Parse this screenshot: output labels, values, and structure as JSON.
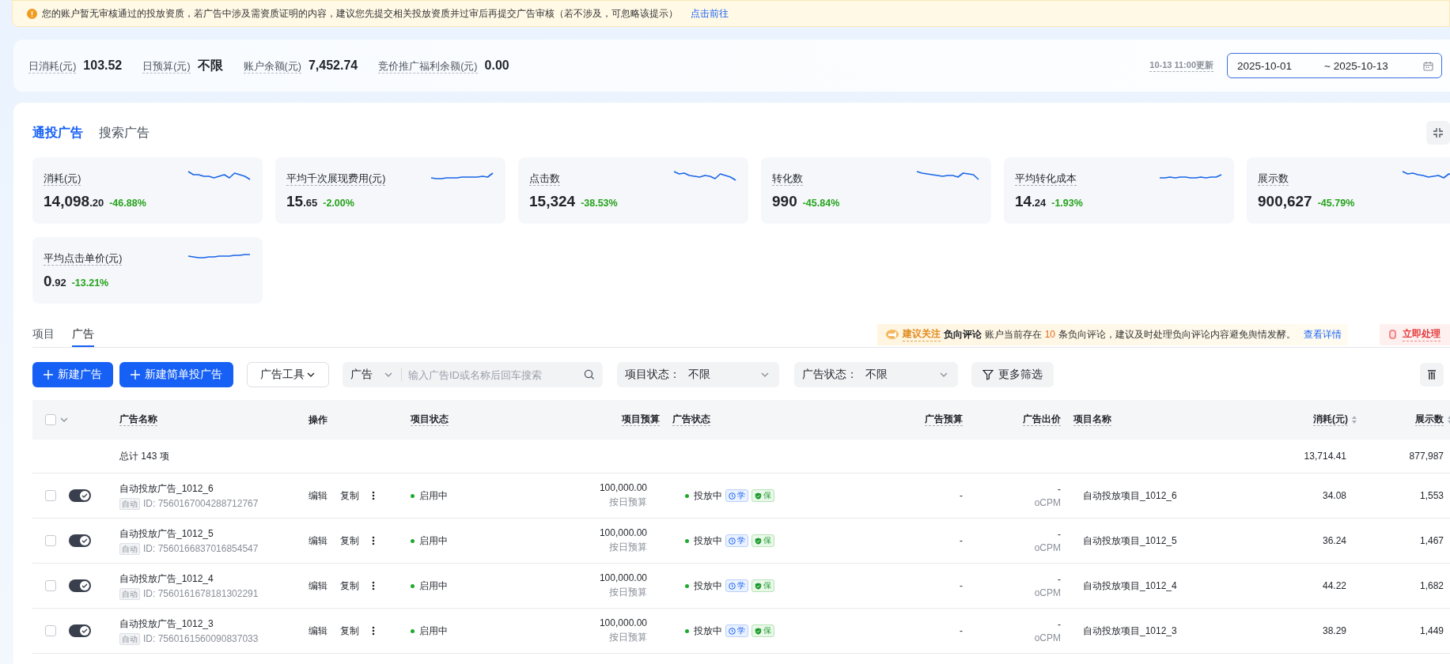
{
  "notice": {
    "text": "您的账户暂无审核通过的投放资质，若广告中涉及需资质证明的内容，建议您先提交相关投放资质并过审后再提交广告审核（若不涉及，可忽略该提示）",
    "link": "点击前往"
  },
  "summary": {
    "stats": [
      {
        "label": "日消耗(元)",
        "value": "103.52"
      },
      {
        "label": "日预算(元)",
        "value": "不限"
      },
      {
        "label": "账户余额(元)",
        "value": "7,452.74"
      },
      {
        "label": "竞价推广福利余额(元)",
        "value": "0.00"
      }
    ],
    "updated": "10-13 11:00更新",
    "date_range": {
      "start": "2025-10-01",
      "end": "~ 2025-10-13"
    }
  },
  "channel_tabs": [
    {
      "label": "通投广告",
      "selected": true
    },
    {
      "label": "搜索广告",
      "selected": false
    }
  ],
  "metrics": [
    {
      "label": "消耗(元)",
      "value": "14,098",
      "fraction": ".20",
      "change": "-46.88%"
    },
    {
      "label": "平均千次展现费用(元)",
      "value": "15",
      "fraction": ".65",
      "change": "-2.00%"
    },
    {
      "label": "点击数",
      "value": "15,324",
      "change": "-38.53%"
    },
    {
      "label": "转化数",
      "value": "990",
      "change": "-45.84%"
    },
    {
      "label": "平均转化成本",
      "value": "14",
      "fraction": ".24",
      "change": "-1.93%"
    },
    {
      "label": "展示数",
      "value": "900,627",
      "change": "-45.79%"
    },
    {
      "label": "平均点击单价(元)",
      "value": "0",
      "fraction": ".92",
      "change": "-13.21%"
    }
  ],
  "level_tabs": [
    {
      "label": "项目",
      "selected": false
    },
    {
      "label": "广告",
      "selected": true
    }
  ],
  "review_alert": {
    "tag": "建议关注",
    "title": "负向评论",
    "text_before": "账户当前存在",
    "count": "10",
    "text_after": "条负向评论，建议及时处理负向评论内容避免舆情发酵。",
    "link": "查看详情"
  },
  "action_alert": {
    "label": "立即处理"
  },
  "toolbar": {
    "buttons": [
      {
        "kind": "primary",
        "label": "新建广告"
      },
      {
        "kind": "primary",
        "label": "新建简单投广告"
      },
      {
        "kind": "dropdown",
        "label": "广告工具"
      }
    ],
    "search": {
      "scope": "广告",
      "placeholder": "输入广告ID或名称后回车搜索"
    },
    "filters": [
      {
        "label": "项目状态：",
        "value": "不限"
      },
      {
        "label": "广告状态：",
        "value": "不限"
      }
    ],
    "more_filters": "更多筛选"
  },
  "table": {
    "select_all": {
      "checked": false
    },
    "columns": [
      {
        "label": "广告名称",
        "hint": true,
        "sortable": false
      },
      {
        "label": "操作",
        "hint": false,
        "sortable": false
      },
      {
        "label": "项目状态",
        "hint": true,
        "sortable": false
      },
      {
        "label": "项目预算",
        "hint": true,
        "sortable": false
      },
      {
        "label": "广告状态",
        "hint": true,
        "sortable": false
      },
      {
        "label": "广告预算",
        "hint": true,
        "sortable": false
      },
      {
        "label": "广告出价",
        "hint": true,
        "sortable": false
      },
      {
        "label": "项目名称",
        "hint": true,
        "sortable": false
      },
      {
        "label": "消耗(元)",
        "hint": true,
        "sortable": true
      },
      {
        "label": "展示数",
        "hint": true,
        "sortable": true
      }
    ],
    "total": {
      "label": "总计 143 项",
      "spend": "13,714.41",
      "impressions": "877,987"
    },
    "rows": [
      {
        "checked": false,
        "on": true,
        "name": "自动投放广告_1012_6",
        "mode": "自动",
        "id": "ID: 7560167004288712767",
        "actions": [
          "编辑",
          "复制"
        ],
        "project_status": "启用中",
        "project_budget": "100,000.00",
        "budget_type": "按日预算",
        "ad_status": "投放中",
        "tags": [
          {
            "kind": "learning",
            "label": "学"
          },
          {
            "kind": "guarantee",
            "label": "保"
          }
        ],
        "ad_budget": "-",
        "bid": "-",
        "bid_type": "oCPM",
        "project_name": "自动投放项目_1012_6",
        "spend": "34.08",
        "impressions": "1,553"
      },
      {
        "checked": false,
        "on": true,
        "name": "自动投放广告_1012_5",
        "mode": "自动",
        "id": "ID: 7560166837016854547",
        "actions": [
          "编辑",
          "复制"
        ],
        "project_status": "启用中",
        "project_budget": "100,000.00",
        "budget_type": "按日预算",
        "ad_status": "投放中",
        "tags": [
          {
            "kind": "learning",
            "label": "学"
          },
          {
            "kind": "guarantee",
            "label": "保"
          }
        ],
        "ad_budget": "-",
        "bid": "-",
        "bid_type": "oCPM",
        "project_name": "自动投放项目_1012_5",
        "spend": "36.24",
        "impressions": "1,467"
      },
      {
        "checked": false,
        "on": true,
        "name": "自动投放广告_1012_4",
        "mode": "自动",
        "id": "ID: 7560161678181302291",
        "actions": [
          "编辑",
          "复制"
        ],
        "project_status": "启用中",
        "project_budget": "100,000.00",
        "budget_type": "按日预算",
        "ad_status": "投放中",
        "tags": [
          {
            "kind": "learning",
            "label": "学"
          },
          {
            "kind": "guarantee",
            "label": "保"
          }
        ],
        "ad_budget": "-",
        "bid": "-",
        "bid_type": "oCPM",
        "project_name": "自动投放项目_1012_4",
        "spend": "44.22",
        "impressions": "1,682"
      },
      {
        "checked": false,
        "on": true,
        "name": "自动投放广告_1012_3",
        "mode": "自动",
        "id": "ID: 7560161560090837033",
        "actions": [
          "编辑",
          "复制"
        ],
        "project_status": "启用中",
        "project_budget": "100,000.00",
        "budget_type": "按日预算",
        "ad_status": "投放中",
        "tags": [
          {
            "kind": "learning",
            "label": "学"
          },
          {
            "kind": "guarantee",
            "label": "保"
          }
        ],
        "ad_budget": "-",
        "bid": "-",
        "bid_type": "oCPM",
        "project_name": "自动投放项目_1012_3",
        "spend": "38.29",
        "impressions": "1,449"
      }
    ]
  }
}
